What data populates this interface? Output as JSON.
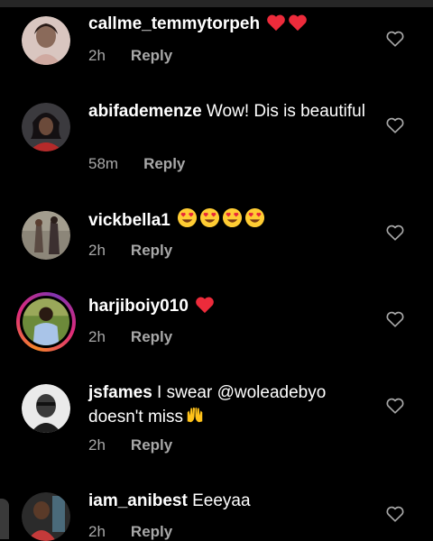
{
  "comments": [
    {
      "username": "callme_temmytorpeh",
      "text": "",
      "emoji": [
        "red-heart",
        "red-heart"
      ],
      "time": "2h",
      "reply": "Reply"
    },
    {
      "username": "abifademenze",
      "text": " Wow! Dis is beautiful",
      "emoji": [],
      "time": "58m",
      "reply": "Reply"
    },
    {
      "username": "vickbella1",
      "text": "",
      "emoji": [
        "heart-eyes",
        "heart-eyes",
        "heart-eyes",
        "heart-eyes"
      ],
      "time": "2h",
      "reply": "Reply"
    },
    {
      "username": "harjiboiy010",
      "text": "",
      "emoji": [
        "red-heart"
      ],
      "time": "2h",
      "reply": "Reply"
    },
    {
      "username": "jsfames",
      "text": " I swear @woleadebyo doesn't miss",
      "emoji": [
        "raised-hands"
      ],
      "time": "2h",
      "reply": "Reply"
    },
    {
      "username": "iam_anibest",
      "text": " Eeeyaa",
      "emoji": [],
      "time": "2h",
      "reply": "Reply"
    }
  ],
  "colors": {
    "background": "#000000",
    "text": "#ffffff",
    "meta": "#a8a8a8",
    "heart": "#ed2b3b",
    "story_ring": "#dd2a7b"
  }
}
